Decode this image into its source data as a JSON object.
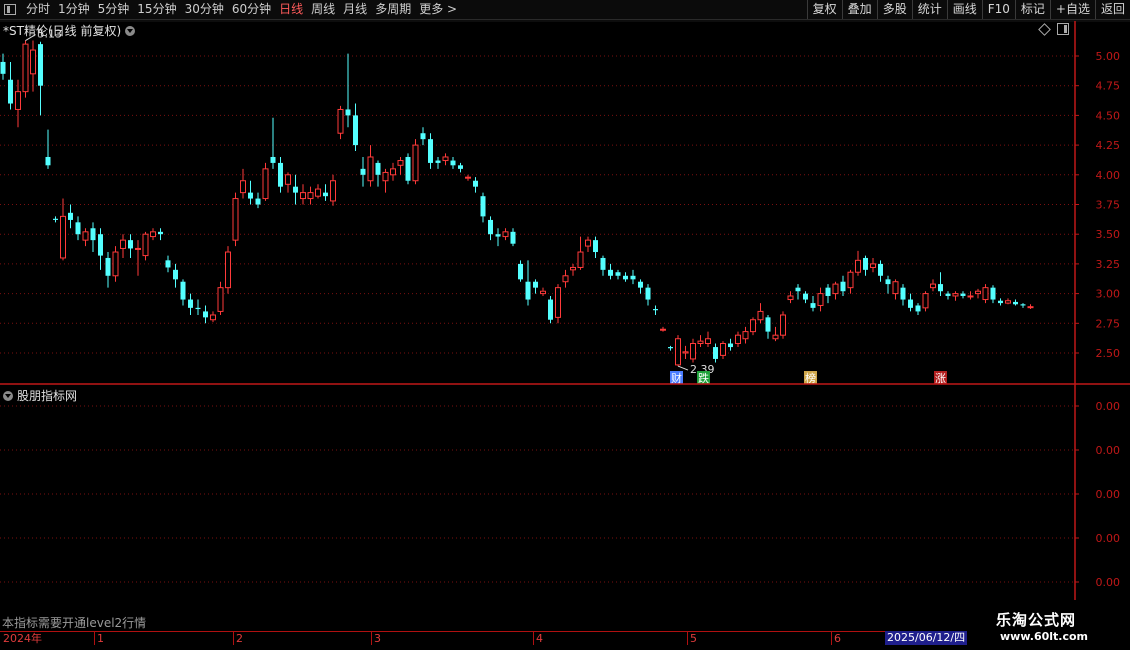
{
  "toolbar": {
    "periods": [
      "分时",
      "1分钟",
      "5分钟",
      "15分钟",
      "30分钟",
      "60分钟",
      "日线",
      "周线",
      "月线",
      "多周期",
      "更多"
    ],
    "active_period": "日线",
    "more_arrow": ">",
    "right_buttons": [
      "复权",
      "叠加",
      "多股",
      "统计",
      "画线",
      "F10",
      "标记",
      "+自选",
      "返回"
    ]
  },
  "main": {
    "title": "*ST精伦(日线 前复权)",
    "y_ticks": [
      "5.00",
      "4.75",
      "4.50",
      "4.25",
      "4.00",
      "3.75",
      "3.50",
      "3.25",
      "3.00",
      "2.75",
      "2.50"
    ],
    "high_label": "5.13",
    "low_label": "2.39",
    "event_markers": [
      {
        "label": "财",
        "color": "#4a7cff"
      },
      {
        "label": "跌",
        "color": "#1fa23a"
      },
      {
        "label": "榜",
        "color": "#cfa64a"
      },
      {
        "label": "涨",
        "color": "#b32020"
      }
    ]
  },
  "sub": {
    "title": "股朋指标网",
    "y_ticks": [
      "0.00",
      "0.00",
      "0.00",
      "0.00",
      "0.00"
    ],
    "note": "本指标需要开通level2行情"
  },
  "time_axis": {
    "year_label": "2024年",
    "month_labels": [
      "1",
      "2",
      "3",
      "4",
      "5",
      "6"
    ],
    "cursor_date": "2025/06/12/四"
  },
  "watermark": {
    "title": "乐淘公式网",
    "url": "www.60lt.com"
  },
  "colors": {
    "up": "#ff3a3a",
    "down": "#54ffff",
    "grid": "#7a1010",
    "axis": "#c01818",
    "text": "#c8c8c8"
  },
  "chart_data": {
    "type": "candlestick",
    "price_range": [
      2.25,
      5.3
    ],
    "candles": [
      [
        4.95,
        4.85,
        5.02,
        4.8
      ],
      [
        4.8,
        4.6,
        4.95,
        4.55
      ],
      [
        4.55,
        4.7,
        4.8,
        4.4
      ],
      [
        4.7,
        5.1,
        5.13,
        4.65
      ],
      [
        4.85,
        5.05,
        5.13,
        4.7
      ],
      [
        5.1,
        4.75,
        5.12,
        4.5
      ],
      [
        4.15,
        4.08,
        4.38,
        4.05
      ],
      [
        3.63,
        3.62,
        3.65,
        3.6
      ],
      [
        3.3,
        3.65,
        3.8,
        3.28
      ],
      [
        3.68,
        3.62,
        3.75,
        3.55
      ],
      [
        3.6,
        3.5,
        3.65,
        3.45
      ],
      [
        3.45,
        3.52,
        3.55,
        3.4
      ],
      [
        3.55,
        3.45,
        3.6,
        3.35
      ],
      [
        3.5,
        3.32,
        3.55,
        3.2
      ],
      [
        3.3,
        3.15,
        3.35,
        3.05
      ],
      [
        3.15,
        3.35,
        3.4,
        3.1
      ],
      [
        3.38,
        3.45,
        3.5,
        3.3
      ],
      [
        3.45,
        3.38,
        3.5,
        3.3
      ],
      [
        3.38,
        3.38,
        3.45,
        3.15
      ],
      [
        3.32,
        3.5,
        3.52,
        3.28
      ],
      [
        3.48,
        3.52,
        3.55,
        3.45
      ],
      [
        3.52,
        3.5,
        3.55,
        3.45
      ],
      [
        3.28,
        3.22,
        3.32,
        3.18
      ],
      [
        3.2,
        3.12,
        3.25,
        3.05
      ],
      [
        3.1,
        2.95,
        3.12,
        2.9
      ],
      [
        2.95,
        2.88,
        3.0,
        2.82
      ],
      [
        2.88,
        2.87,
        2.95,
        2.82
      ],
      [
        2.85,
        2.8,
        2.9,
        2.75
      ],
      [
        2.78,
        2.82,
        2.85,
        2.76
      ],
      [
        2.85,
        3.05,
        3.1,
        2.82
      ],
      [
        3.05,
        3.35,
        3.4,
        3.0
      ],
      [
        3.45,
        3.8,
        3.85,
        3.4
      ],
      [
        3.85,
        3.95,
        4.05,
        3.8
      ],
      [
        3.85,
        3.8,
        3.95,
        3.75
      ],
      [
        3.8,
        3.75,
        3.85,
        3.72
      ],
      [
        3.8,
        4.05,
        4.1,
        3.78
      ],
      [
        4.15,
        4.1,
        4.48,
        4.05
      ],
      [
        4.1,
        3.9,
        4.15,
        3.85
      ],
      [
        3.92,
        4.0,
        4.02,
        3.85
      ],
      [
        3.9,
        3.85,
        4.0,
        3.75
      ],
      [
        3.8,
        3.85,
        3.92,
        3.75
      ],
      [
        3.8,
        3.85,
        3.9,
        3.75
      ],
      [
        3.82,
        3.88,
        3.92,
        3.8
      ],
      [
        3.85,
        3.82,
        3.92,
        3.78
      ],
      [
        3.78,
        3.95,
        4.0,
        3.74
      ],
      [
        4.35,
        4.55,
        4.58,
        4.3
      ],
      [
        4.55,
        4.5,
        5.02,
        4.4
      ],
      [
        4.5,
        4.25,
        4.6,
        4.2
      ],
      [
        4.05,
        4.0,
        4.15,
        3.9
      ],
      [
        3.95,
        4.15,
        4.25,
        3.9
      ],
      [
        4.1,
        4.0,
        4.12,
        3.9
      ],
      [
        3.95,
        4.02,
        4.05,
        3.85
      ],
      [
        4.0,
        4.05,
        4.1,
        3.95
      ],
      [
        4.08,
        4.12,
        4.15,
        4.0
      ],
      [
        4.15,
        3.95,
        4.18,
        3.92
      ],
      [
        3.95,
        4.25,
        4.3,
        3.92
      ],
      [
        4.35,
        4.3,
        4.4,
        4.25
      ],
      [
        4.3,
        4.1,
        4.35,
        4.05
      ],
      [
        4.12,
        4.1,
        4.15,
        4.05
      ],
      [
        4.12,
        4.15,
        4.18,
        4.08
      ],
      [
        4.12,
        4.08,
        4.15,
        4.05
      ],
      [
        4.08,
        4.05,
        4.1,
        4.02
      ],
      [
        3.98,
        3.98,
        4.0,
        3.95
      ],
      [
        3.95,
        3.9,
        3.98,
        3.85
      ],
      [
        3.82,
        3.65,
        3.85,
        3.6
      ],
      [
        3.62,
        3.5,
        3.65,
        3.45
      ],
      [
        3.5,
        3.48,
        3.55,
        3.4
      ],
      [
        3.48,
        3.52,
        3.55,
        3.45
      ],
      [
        3.52,
        3.42,
        3.55,
        3.4
      ],
      [
        3.25,
        3.12,
        3.28,
        3.1
      ],
      [
        3.1,
        2.95,
        3.28,
        2.9
      ],
      [
        3.1,
        3.05,
        3.12,
        3.0
      ],
      [
        3.0,
        3.02,
        3.05,
        2.98
      ],
      [
        2.95,
        2.78,
        2.98,
        2.75
      ],
      [
        2.8,
        3.05,
        3.08,
        2.75
      ],
      [
        3.1,
        3.15,
        3.2,
        3.05
      ],
      [
        3.2,
        3.22,
        3.25,
        3.15
      ],
      [
        3.22,
        3.35,
        3.48,
        3.2
      ],
      [
        3.4,
        3.45,
        3.48,
        3.35
      ],
      [
        3.45,
        3.35,
        3.48,
        3.3
      ],
      [
        3.3,
        3.2,
        3.32,
        3.15
      ],
      [
        3.2,
        3.15,
        3.25,
        3.12
      ],
      [
        3.18,
        3.15,
        3.2,
        3.12
      ],
      [
        3.15,
        3.12,
        3.18,
        3.1
      ],
      [
        3.15,
        3.12,
        3.2,
        3.08
      ],
      [
        3.1,
        3.05,
        3.12,
        3.0
      ],
      [
        3.05,
        2.95,
        3.08,
        2.9
      ],
      [
        2.87,
        2.86,
        2.9,
        2.82
      ],
      [
        2.7,
        2.7,
        2.72,
        2.68
      ],
      [
        2.55,
        2.54,
        2.56,
        2.52
      ],
      [
        2.4,
        2.62,
        2.65,
        2.39
      ],
      [
        2.5,
        2.51,
        2.56,
        2.45
      ],
      [
        2.45,
        2.58,
        2.62,
        2.42
      ],
      [
        2.58,
        2.6,
        2.65,
        2.55
      ],
      [
        2.58,
        2.62,
        2.68,
        2.55
      ],
      [
        2.55,
        2.45,
        2.58,
        2.42
      ],
      [
        2.48,
        2.58,
        2.6,
        2.45
      ],
      [
        2.58,
        2.55,
        2.62,
        2.52
      ],
      [
        2.58,
        2.65,
        2.68,
        2.55
      ],
      [
        2.62,
        2.68,
        2.72,
        2.58
      ],
      [
        2.68,
        2.78,
        2.8,
        2.65
      ],
      [
        2.78,
        2.85,
        2.92,
        2.75
      ],
      [
        2.8,
        2.68,
        2.82,
        2.62
      ],
      [
        2.62,
        2.65,
        2.72,
        2.6
      ],
      [
        2.65,
        2.82,
        2.85,
        2.62
      ],
      [
        2.95,
        2.98,
        3.02,
        2.92
      ],
      [
        3.05,
        3.02,
        3.08,
        2.95
      ],
      [
        3.0,
        2.95,
        3.02,
        2.92
      ],
      [
        2.92,
        2.88,
        2.98,
        2.85
      ],
      [
        2.9,
        3.0,
        3.05,
        2.85
      ],
      [
        3.05,
        2.98,
        3.08,
        2.92
      ],
      [
        3.0,
        3.08,
        3.1,
        2.95
      ],
      [
        3.1,
        3.02,
        3.15,
        2.98
      ],
      [
        3.05,
        3.18,
        3.2,
        3.0
      ],
      [
        3.18,
        3.28,
        3.36,
        3.15
      ],
      [
        3.3,
        3.2,
        3.32,
        3.15
      ],
      [
        3.22,
        3.25,
        3.3,
        3.18
      ],
      [
        3.25,
        3.15,
        3.28,
        3.1
      ],
      [
        3.12,
        3.08,
        3.15,
        3.0
      ],
      [
        3.0,
        3.1,
        3.12,
        2.95
      ],
      [
        3.05,
        2.95,
        3.08,
        2.9
      ],
      [
        2.95,
        2.88,
        3.0,
        2.85
      ],
      [
        2.9,
        2.85,
        2.92,
        2.82
      ],
      [
        2.88,
        3.0,
        3.02,
        2.85
      ],
      [
        3.05,
        3.08,
        3.12,
        3.02
      ],
      [
        3.08,
        3.02,
        3.18,
        2.98
      ],
      [
        3.0,
        2.98,
        3.02,
        2.95
      ],
      [
        2.98,
        3.0,
        3.02,
        2.94
      ],
      [
        3.0,
        2.98,
        3.02,
        2.96
      ],
      [
        2.98,
        2.98,
        3.02,
        2.95
      ],
      [
        3.0,
        3.02,
        3.04,
        2.96
      ],
      [
        2.95,
        3.05,
        3.08,
        2.92
      ],
      [
        3.05,
        2.95,
        3.07,
        2.92
      ],
      [
        2.94,
        2.92,
        2.96,
        2.9
      ],
      [
        2.92,
        2.94,
        2.96,
        2.91
      ],
      [
        2.93,
        2.91,
        2.95,
        2.9
      ],
      [
        2.91,
        2.9,
        2.92,
        2.88
      ],
      [
        2.89,
        2.89,
        2.91,
        2.87
      ]
    ]
  }
}
